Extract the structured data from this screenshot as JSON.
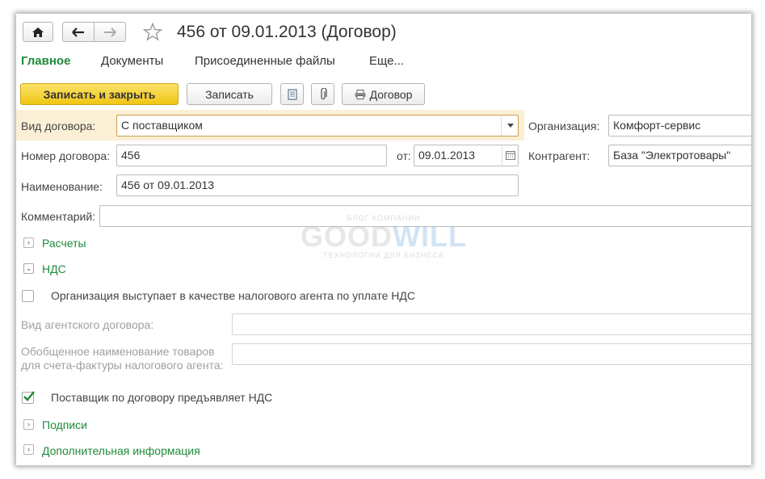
{
  "window": {
    "title": "456 от 09.01.2013 (Договор)",
    "home_icon": "home-icon",
    "back_icon": "arrow-left-icon",
    "forward_icon": "arrow-right-icon",
    "favorite_icon": "star-icon"
  },
  "nav": {
    "main": "Главное",
    "documents": "Документы",
    "attached_files": "Присоединенные файлы",
    "more": "Еще..."
  },
  "toolbar": {
    "save_close": "Записать и закрыть",
    "save": "Записать",
    "contract": "Договор",
    "doc_icon": "document-icon",
    "attach_icon": "paperclip-icon",
    "print_icon": "printer-icon"
  },
  "form": {
    "contract_type_label": "Вид договора:",
    "contract_type_value": "С поставщиком",
    "organization_label": "Организация:",
    "organization_value": "Комфорт-сервис",
    "number_label": "Номер договора:",
    "number_value": "456",
    "date_label": "от:",
    "date_value": "09.01.2013",
    "counterparty_label": "Контрагент:",
    "counterparty_value": "База \"Электротовары\"",
    "name_label": "Наименование:",
    "name_value": "456 от 09.01.2013",
    "comment_label": "Комментарий:",
    "comment_value": ""
  },
  "watermark": {
    "top": "БЛОГ КОМПАНИИ",
    "brand_left": "GOOD",
    "brand_right": "WILL",
    "bottom": "ТЕХНОЛОГИИ ДЛЯ БИЗНЕСА"
  },
  "sections": {
    "payments": "Расчеты",
    "vat": "НДС",
    "signatures": "Подписи",
    "additional": "Дополнительная информация"
  },
  "vat": {
    "tax_agent_label": "Организация выступает в качестве налогового агента по уплате НДС",
    "tax_agent_checked": false,
    "agent_contract_label": "Вид агентского договора:",
    "agent_contract_value": "",
    "goods_name_label_1": "Обобщенное наименование товаров",
    "goods_name_label_2": "для счета-фактуры налогового агента:",
    "goods_name_value": "",
    "supplier_vat_label": "Поставщик по договору предъявляет НДС",
    "supplier_vat_checked": true
  },
  "colors": {
    "accent_green": "#1f8a3a",
    "primary_button": "#f5d23a",
    "highlight_row": "#fbefd5"
  }
}
